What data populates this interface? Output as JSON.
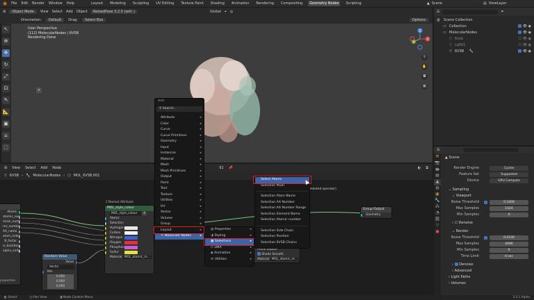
{
  "topbar": {
    "menus": [
      "File",
      "Edit",
      "Render",
      "Window",
      "Help"
    ],
    "tabs": [
      "Layout",
      "Modeling",
      "Sculpting",
      "UV Editing",
      "Texture Paint",
      "Shading",
      "Animation",
      "Rendering",
      "Compositing",
      "Geometry Nodes",
      "Scripting"
    ],
    "active_tab": "Geometry Nodes",
    "scene": "Scene",
    "view_layer": "ViewLayer"
  },
  "viewport": {
    "mode": "Object Mode",
    "menus": [
      "View",
      "Select",
      "Add",
      "Object"
    ],
    "addon": "ReloadPose 3.2.5 (self..)",
    "transform": "Global",
    "orientation_label": "Orientation:",
    "orientation": "Default",
    "drag_label": "Drag:",
    "drag": "Select Box",
    "options": "Options",
    "info_line1": "User Perspective",
    "info_line2": "(112) MolecularNodes | 6VSB",
    "info_line3": "Rendering Done",
    "axis_x": "X",
    "axis_y": "Y",
    "axis_z": "Z"
  },
  "outliner": {
    "rows": [
      {
        "label": "Scene Collection",
        "indent": 0
      },
      {
        "label": "Collection",
        "indent": 1
      },
      {
        "label": "MolecularNodes",
        "indent": 1
      },
      {
        "label": "6vsb",
        "indent": 2
      },
      {
        "label": "cg001",
        "indent": 2
      },
      {
        "label": "6VSB",
        "indent": 2
      }
    ]
  },
  "properties": {
    "scene_label": "Scene",
    "render_engine_label": "Render Engine",
    "render_engine": "Cycles",
    "feature_set_label": "Feature Set",
    "feature_set": "Supported",
    "device_label": "Device",
    "device": "GPU Compute",
    "sampling": "Sampling",
    "viewport_sec": "Viewport",
    "noise_threshold_label": "Noise Threshold",
    "noise_threshold_vp": "0.1000",
    "max_samples_label": "Max Samples",
    "max_samples_vp": "1024",
    "min_samples_label": "Min Samples",
    "min_samples_vp": "0",
    "denoise": "Denoise",
    "render_sec": "Render",
    "noise_threshold_r": "0.0100",
    "max_samples_r": "4096",
    "min_samples_r": "0",
    "time_limit_label": "Time Limit",
    "time_limit": "0 sec",
    "denoise2": "Denoise",
    "advanced": "Advanced",
    "light_paths": "Light Paths",
    "volumes": "Volumes"
  },
  "node_editor": {
    "menus": [
      "View",
      "Select",
      "Add",
      "Node"
    ],
    "frame": "91",
    "breadcrumb": [
      "6VSB",
      "MolecularNodes",
      "MOL_6VSB.001"
    ],
    "left_node_rows": [
      "Atoms",
      "atomic_number",
      "chain_number",
      "res_number",
      "AA_name",
      "atom_index",
      "B_factor",
      "is_backbone",
      "alpha_carbon"
    ],
    "rv_title": "Random Value",
    "rv_value": "Value",
    "rv_type": "Vector",
    "rv_min": "Min",
    "rv_v1": "0.000",
    "rv_v2": "0.000",
    "rv_v3": "0.000",
    "frag_label": "properties",
    "named_attr_title": "2 Named Attribute",
    "style_title": "MOL_style_colour",
    "style_node_label": "MOL_style_colour",
    "style_num": "8",
    "style_rows": [
      {
        "label": "Atoms",
        "color": ""
      },
      {
        "label": "Selection",
        "color": ""
      },
      {
        "label": "Hydrogen",
        "color": "#e8e8e8"
      },
      {
        "label": "Carbon",
        "color": "#f2f2f2"
      },
      {
        "label": "Nitrogen",
        "color": "#3b63d9"
      },
      {
        "label": "Oxygen",
        "color": "#e8303a"
      },
      {
        "label": "Phosphorus",
        "color": "#d25ad8"
      },
      {
        "label": "Sulfur",
        "color": "#e8e040"
      }
    ],
    "material_label": "Material",
    "material_value": "MOL_atomic_m...",
    "group_output_title": "Group Output",
    "group_output_row": "Geometry",
    "partial_rows": [
      "Prefix Ribbon",
      "Shade Smooth"
    ],
    "partial_material": "Material",
    "partial_material_value": "MOL_atomic_m...",
    "tooltip": "(undocumented operator)."
  },
  "add_menu": {
    "title": "Add",
    "search": "Search...",
    "items": [
      "Attribute",
      "Color",
      "Curve",
      "Curve Primitives",
      "Geometry",
      "Input",
      "Instances",
      "Material",
      "Mesh",
      "Mesh Primitives",
      "Output",
      "Point",
      "Text",
      "Texture",
      "Utilities",
      "UV",
      "Vector",
      "Volume",
      "Group",
      "Layout",
      "Molecular Nodes"
    ]
  },
  "mn_submenu": {
    "items": [
      "Properties",
      "Styling",
      "Selections",
      "DNA",
      "Animation",
      "Utilities"
    ]
  },
  "selections_submenu": {
    "items": [
      "Select Atoms",
      "Selection Multi",
      "Selection Atom Name",
      "Selection AA Number",
      "Selection AA Number Range",
      "Selection Element Name",
      "Selection Atomic number",
      "Selection Side Chain",
      "Selection Position",
      "Selection 6VSB Chains"
    ]
  },
  "status": {
    "items": [
      "Select",
      "Pan View",
      "Node Context Menu"
    ],
    "version": "3.3.1 Alpha"
  }
}
